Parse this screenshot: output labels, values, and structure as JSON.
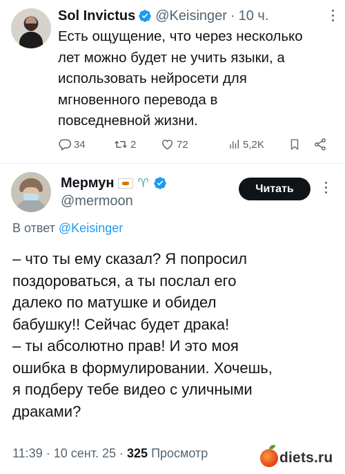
{
  "tweet1": {
    "author_name": "Sol Invictus",
    "author_handle": "@Keisinger",
    "separator": "·",
    "time_ago": "10 ч.",
    "text_lines": [
      "Есть ощущение, что через несколько",
      "лет можно будет не учить языки, а",
      "использовать нейросети для",
      "мгновенного перевода в",
      "повседневной жизни."
    ],
    "actions": {
      "replies": "34",
      "reposts": "2",
      "likes": "72",
      "views": "5,2K"
    }
  },
  "tweet2": {
    "author_name": "Мермун",
    "author_handle": "@mermoon",
    "follow_label": "Читать",
    "reply_prefix": "В ответ",
    "reply_to_handle": "@Keisinger",
    "text_lines": [
      "– что ты ему сказал? Я попросил",
      "поздороваться, а ты послал его",
      "далеко по матушке и обидел",
      "бабушку!! Сейчас будет драка!",
      "– ты абсолютно прав! И это моя",
      "ошибка в формулировании. Хочешь,",
      "я подберу тебе видео с уличными",
      "драками?"
    ],
    "time": "11:39",
    "date": "10 сент. 25",
    "views_count": "325",
    "views_label": "Просмотр"
  },
  "watermark": "diets.ru",
  "colors": {
    "primary_text": "#0f1419",
    "secondary_text": "#536471",
    "accent_blue": "#1d9bf0",
    "button_bg": "#0f1419"
  },
  "icons": [
    "verified-badge-icon",
    "more-options-icon",
    "reply-icon",
    "repost-icon",
    "like-icon",
    "views-icon",
    "bookmark-icon",
    "share-icon",
    "cyprus-flag-icon",
    "mermaid-emoji-icon"
  ]
}
